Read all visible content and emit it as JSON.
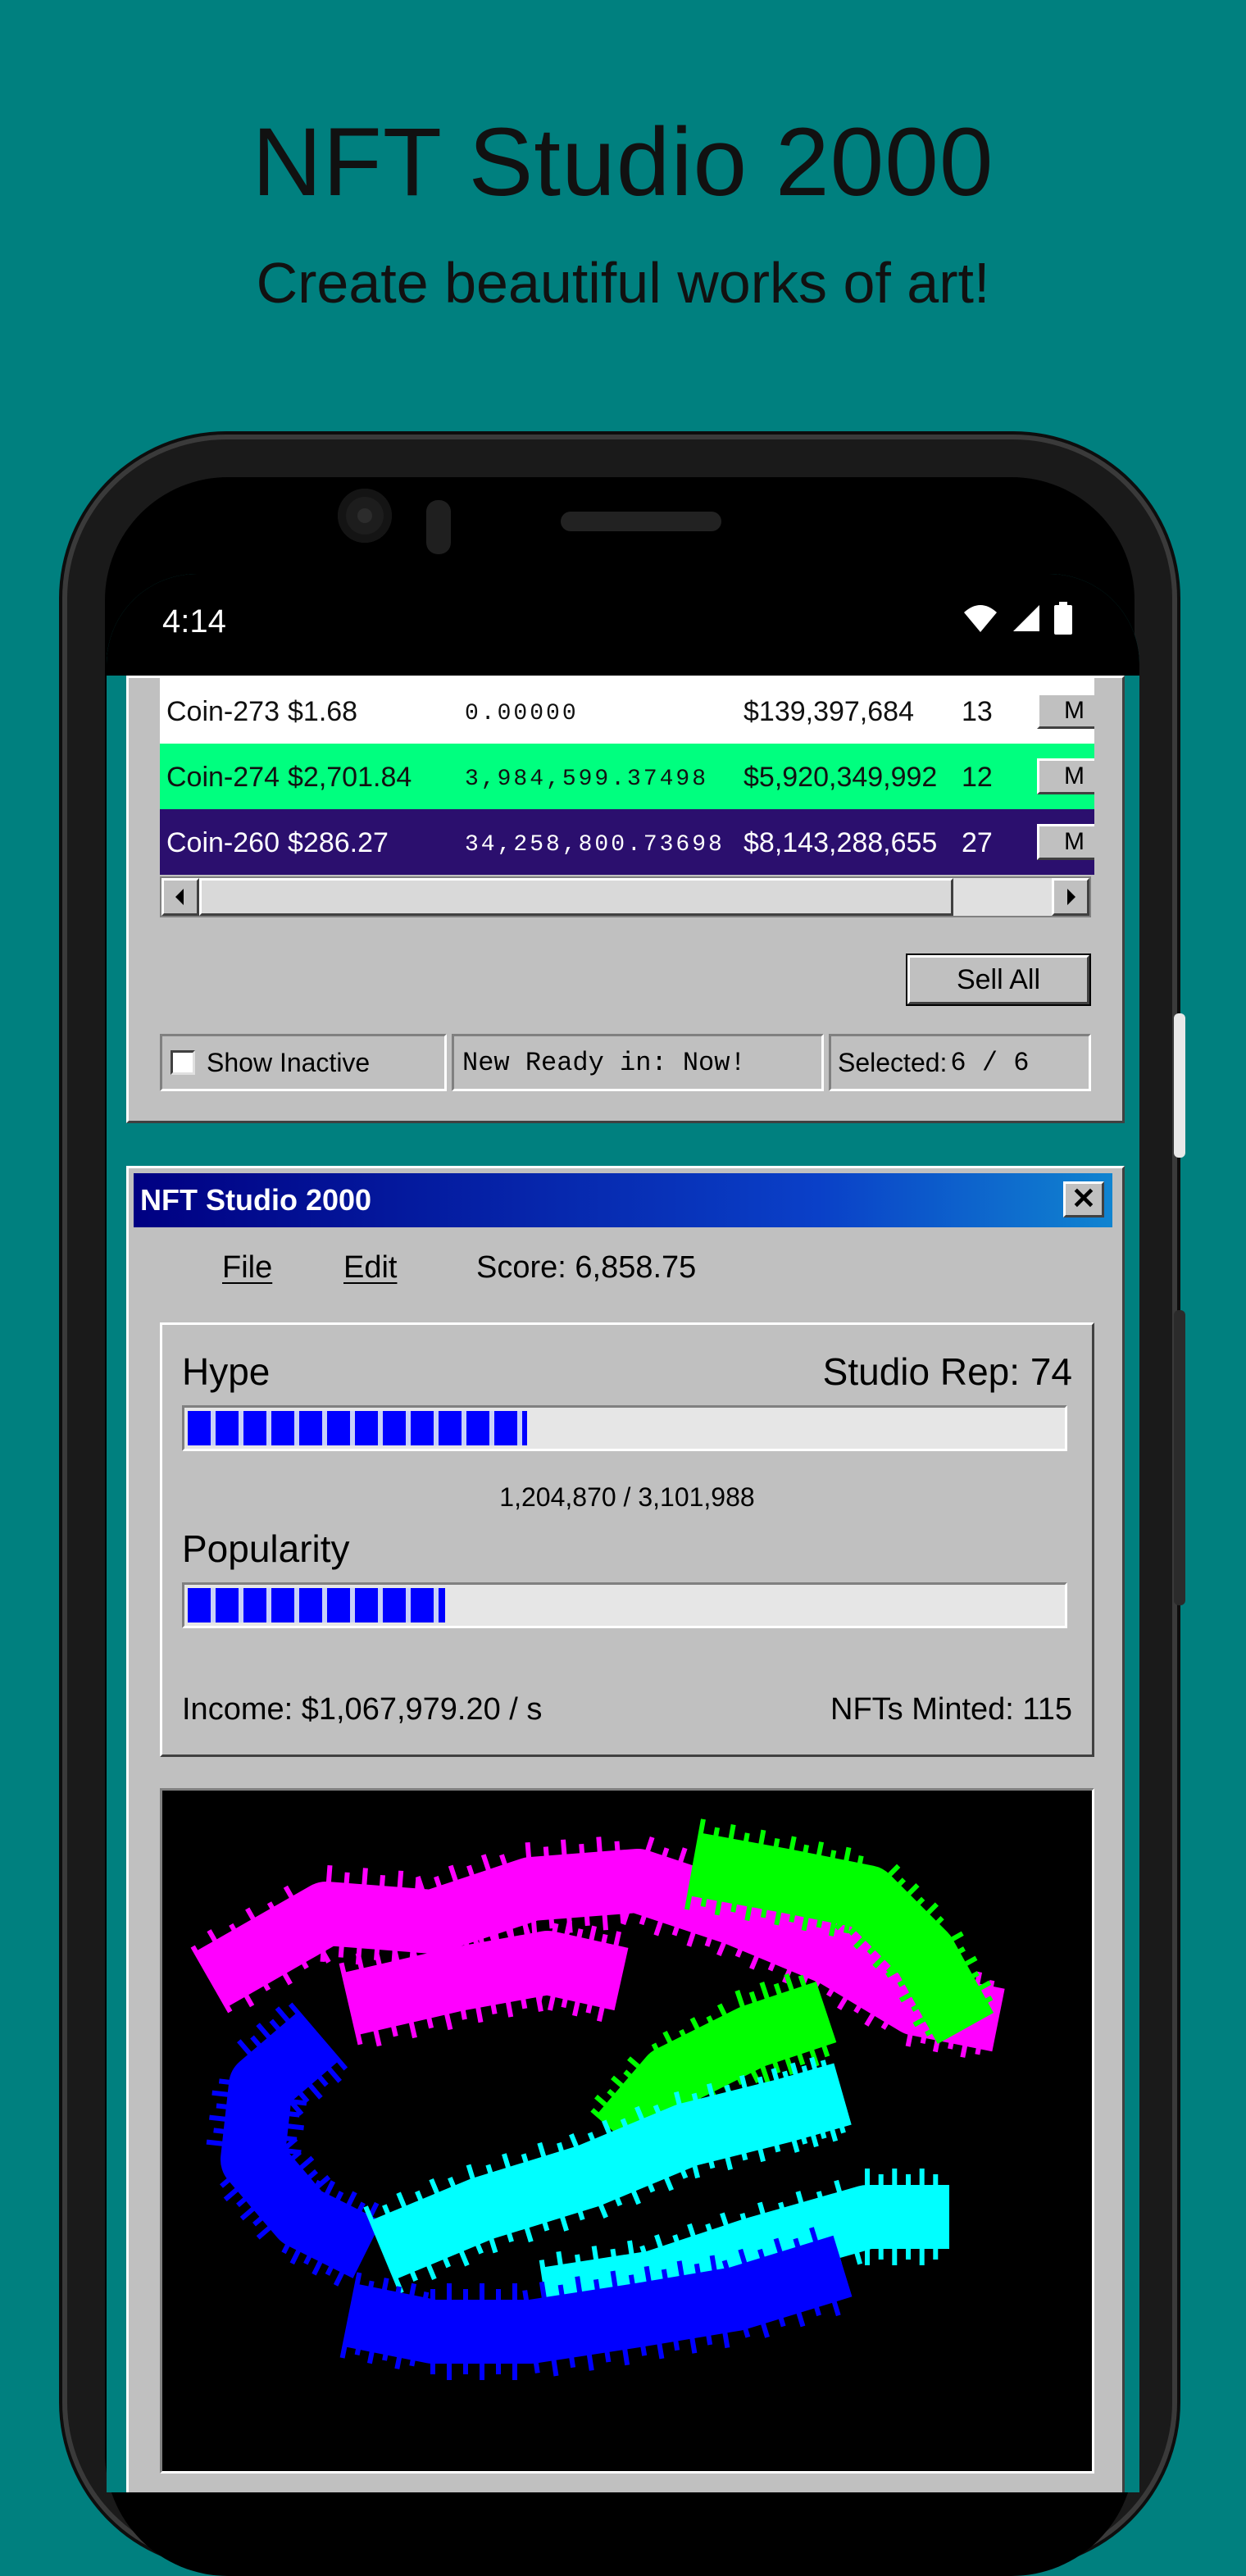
{
  "promo": {
    "title": "NFT Studio 2000",
    "subtitle": "Create beautiful works of art!"
  },
  "status_bar": {
    "time": "4:14"
  },
  "coins_table": {
    "rows": [
      {
        "name": "Coin-273",
        "price": "$1.68",
        "holding": "0.00000",
        "market_cap": "$139,397,684",
        "count": "13",
        "button": "M",
        "bg": "#FFFFFF",
        "fg": "#111111"
      },
      {
        "name": "Coin-274",
        "price": "$2,701.84",
        "holding": "3,984,599.37498",
        "market_cap": "$5,920,349,992",
        "count": "12",
        "button": "M",
        "bg": "#00FF7F",
        "fg": "#111111"
      },
      {
        "name": "Coin-260",
        "price": "$286.27",
        "holding": "34,258,800.73698",
        "market_cap": "$8,143,288,655",
        "count": "27",
        "button": "M",
        "bg": "#2B0F6E",
        "fg": "#FFFFFF"
      }
    ]
  },
  "actions": {
    "sell_all": "Sell All"
  },
  "status_fields": {
    "show_inactive": "Show Inactive",
    "show_inactive_checked": false,
    "new_ready": "New Ready in: Now!",
    "selected_label": "Selected:",
    "selected_value": "6 / 6"
  },
  "studio_window": {
    "title": "NFT Studio 2000",
    "close": "✕",
    "menu": {
      "file": "File",
      "edit": "Edit"
    },
    "score": "Score: 6,858.75",
    "hype_label": "Hype",
    "studio_rep": "Studio Rep: 74",
    "hype_value": "1,204,870 / 3,101,988",
    "hype_fraction": 0.3884,
    "popularity_label": "Popularity",
    "popularity_fraction": 0.295,
    "income": "Income: $1,067,979.20 / s",
    "nfts_minted": "NFTs Minted: 115"
  },
  "colors": {
    "background": "#00807F",
    "window": "#C0C0C0",
    "progress": "#0000FF",
    "art": [
      "#FF00FF",
      "#00FF00",
      "#00FFFF",
      "#0000FF"
    ]
  }
}
